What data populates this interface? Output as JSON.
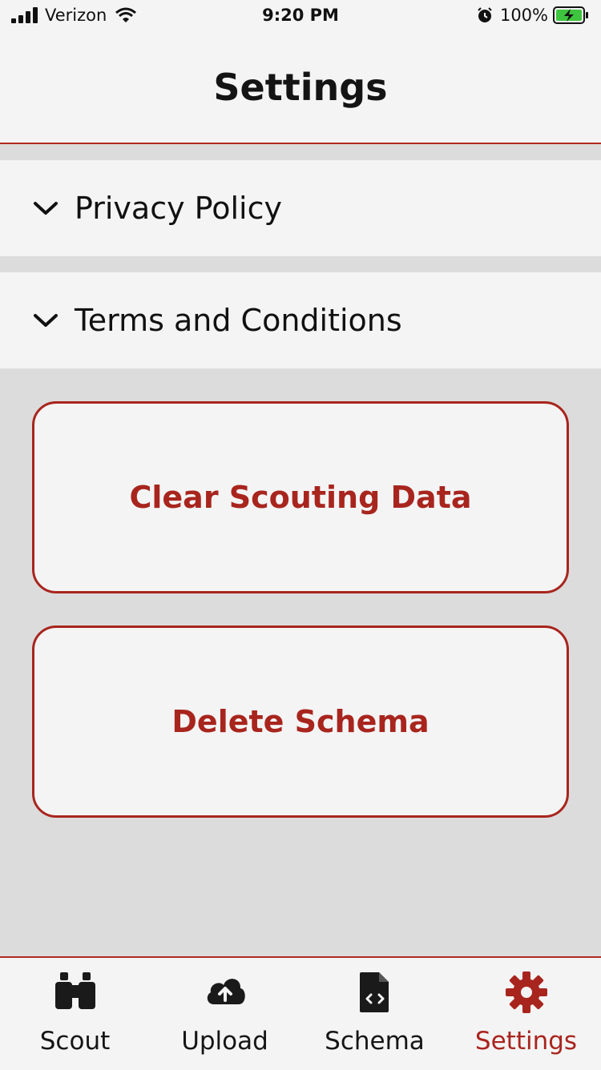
{
  "status_bar": {
    "carrier": "Verizon",
    "time": "9:20 PM",
    "battery": "100%"
  },
  "header": {
    "title": "Settings"
  },
  "sections": [
    {
      "label": "Privacy Policy",
      "icon": "chevron-down-icon"
    },
    {
      "label": "Terms and Conditions",
      "icon": "chevron-down-icon"
    }
  ],
  "actions": {
    "clear_label": "Clear Scouting Data",
    "delete_label": "Delete Schema"
  },
  "tabs": [
    {
      "label": "Scout",
      "icon": "binoculars-icon"
    },
    {
      "label": "Upload",
      "icon": "cloud-upload-icon"
    },
    {
      "label": "Schema",
      "icon": "file-code-icon"
    },
    {
      "label": "Settings",
      "icon": "gear-icon",
      "active": true
    }
  ],
  "colors": {
    "accent": "#a8251e",
    "background": "#dcdcdc",
    "surface": "#f4f4f4",
    "battery": "#3ec43e"
  }
}
